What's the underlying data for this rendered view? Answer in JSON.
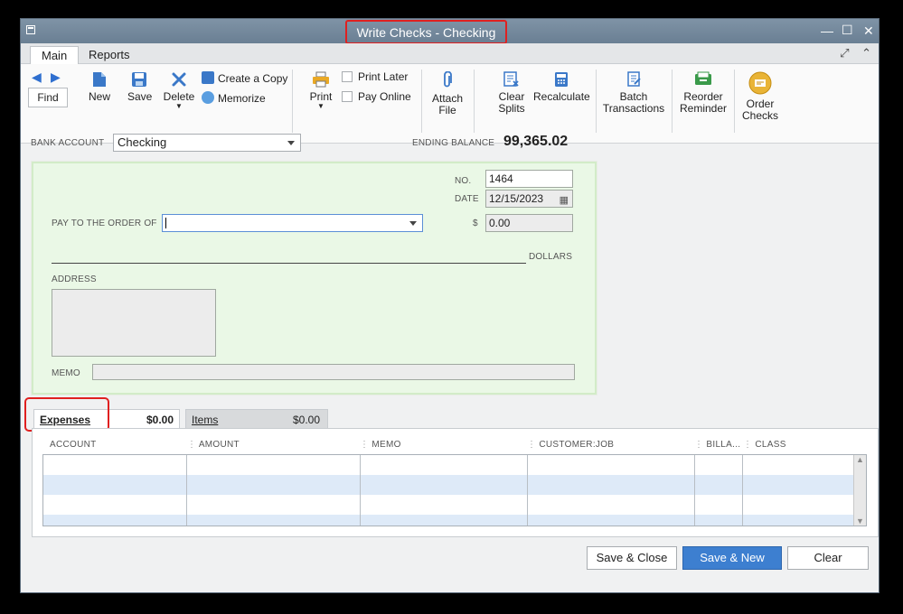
{
  "window": {
    "title": "Write Checks - Checking"
  },
  "tabs": [
    "Main",
    "Reports"
  ],
  "toolbar": {
    "find": "Find",
    "new": "New",
    "save": "Save",
    "delete": "Delete",
    "create_copy": "Create a Copy",
    "memorize": "Memorize",
    "print": "Print",
    "print_later": "Print Later",
    "pay_online": "Pay Online",
    "attach_file_1": "Attach",
    "attach_file_2": "File",
    "clear_splits_1": "Clear",
    "clear_splits_2": "Splits",
    "recalculate": "Recalculate",
    "batch_1": "Batch",
    "batch_2": "Transactions",
    "reorder_1": "Reorder",
    "reorder_2": "Reminder",
    "order_1": "Order",
    "order_2": "Checks"
  },
  "header": {
    "bank_account_label": "BANK ACCOUNT",
    "bank_account_value": "Checking",
    "ending_balance_label": "ENDING BALANCE",
    "ending_balance_value": "99,365.02"
  },
  "check": {
    "no_label": "NO.",
    "no_value": "1464",
    "date_label": "DATE",
    "date_value": "12/15/2023",
    "pay_to_label": "PAY TO THE ORDER OF",
    "pay_to_value": "",
    "dollar_sign": "$",
    "amount_value": "0.00",
    "dollars_label": "DOLLARS",
    "address_label": "ADDRESS",
    "memo_label": "MEMO"
  },
  "detail_tabs": {
    "expenses_label": "Expenses",
    "expenses_total": "$0.00",
    "items_label": "Items",
    "items_total": "$0.00"
  },
  "grid": {
    "columns": [
      "ACCOUNT",
      "AMOUNT",
      "MEMO",
      "CUSTOMER:JOB",
      "BILLA...",
      "CLASS"
    ]
  },
  "buttons": {
    "save_close": "Save & Close",
    "save_new": "Save & New",
    "clear": "Clear"
  },
  "colors": {
    "check_bg": "#eaf8e6",
    "primary_button": "#3d7fd0",
    "highlight": "#e02020"
  }
}
